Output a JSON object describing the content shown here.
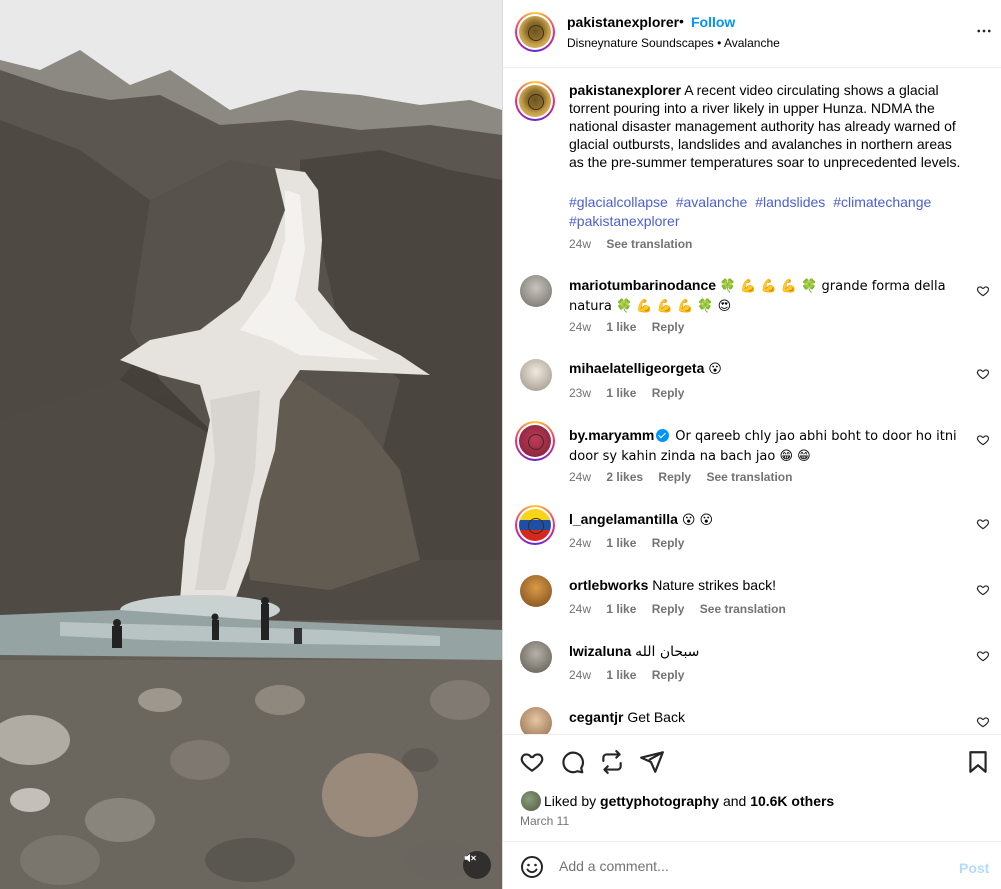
{
  "post": {
    "username": "pakistanexplorer",
    "follow_label": "Follow",
    "dot": "•",
    "subtitle": "Disneynature Soundscapes • Avalanche",
    "caption_user": "pakistanexplorer",
    "caption_text": "A recent video circulating shows a glacial torrent pouring into a river likely in upper Hunza. NDMA the national disaster management authority has already warned of glacial outbursts, landslides and avalanches in northern areas as the pre-summer temperatures soar to unprecedented levels.",
    "hashtags": [
      "#glacialcollapse",
      "#avalanche",
      "#landslides",
      "#climatechange",
      "#pakistanexplorer"
    ],
    "caption_time": "24w",
    "see_translation": "See translation"
  },
  "comments": [
    {
      "user": "mariotumbarinodance",
      "text": "🍀 💪 💪 💪 🍀 grande forma della natura 🍀 💪 💪 💪 🍀 😍",
      "time": "24w",
      "likes": "1 like",
      "reply": "Reply",
      "extra": ""
    },
    {
      "user": "mihaelatelligeorgeta",
      "text": "😮",
      "time": "23w",
      "likes": "1 like",
      "reply": "Reply",
      "extra": ""
    },
    {
      "user": "by.maryamm",
      "text": "Or qareeb chly jao abhi boht to door ho itni door sy kahin zinda na bach jao 😁 😁",
      "time": "24w",
      "likes": "2 likes",
      "reply": "Reply",
      "extra": "See translation"
    },
    {
      "user": "l_angelamantilla",
      "text": "😮 😮",
      "time": "24w",
      "likes": "1 like",
      "reply": "Reply",
      "extra": ""
    },
    {
      "user": "ortlebworks",
      "text": "Nature strikes back!",
      "time": "24w",
      "likes": "1 like",
      "reply": "Reply",
      "extra": "See translation"
    },
    {
      "user": "lwizaluna",
      "text": "سبحان الله",
      "time": "24w",
      "likes": "1 like",
      "reply": "Reply",
      "extra": ""
    },
    {
      "user": "cegantjr",
      "text": "Get Back",
      "time": "",
      "likes": "",
      "reply": "",
      "extra": ""
    }
  ],
  "likes": {
    "prefix": "Liked by",
    "user": "gettyphotography",
    "and": "and",
    "others": "10.6K others"
  },
  "date": "March 11",
  "add_comment": {
    "placeholder": "Add a comment...",
    "post_label": "Post"
  },
  "icons": {
    "more": "more-horizontal-icon",
    "like": "heart-icon",
    "comment": "comment-bubble-icon",
    "share": "share-plane-icon",
    "repost": "repost-icon",
    "save": "bookmark-icon",
    "emoji": "emoji-icon",
    "mute": "muted-speaker-icon"
  },
  "colors": {
    "link_blue": "#0095f6",
    "hashtag": "#4a5fd0",
    "muted_text": "#737373",
    "post_disabled": "#b3dbff"
  }
}
